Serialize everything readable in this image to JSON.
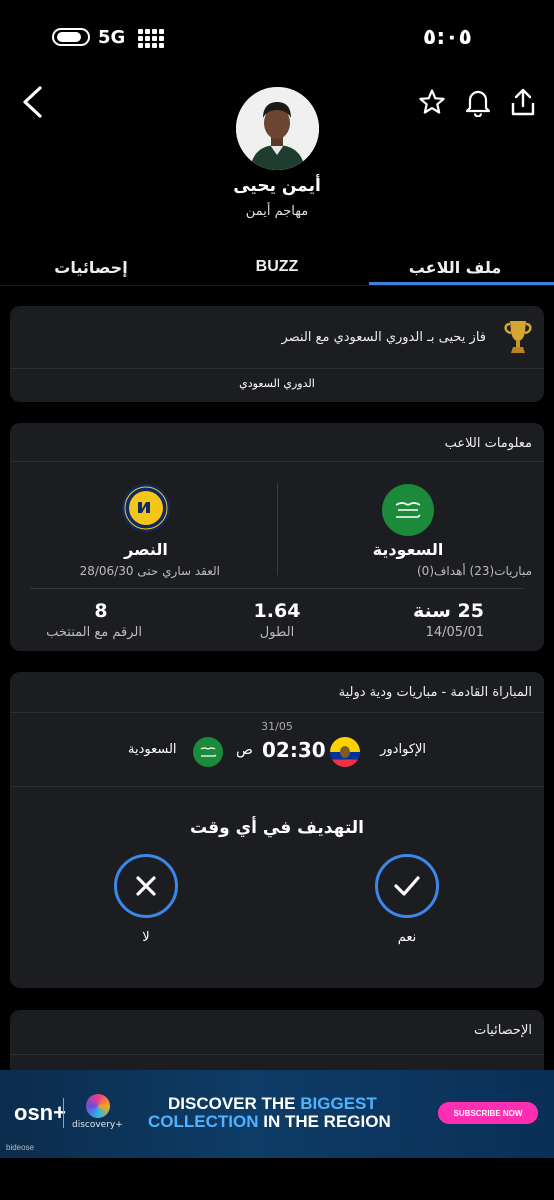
{
  "status_bar": {
    "network": "5G",
    "time": "٥:٠٥"
  },
  "header": {
    "back_icon": "chevron-left-icon",
    "star_icon": "star-icon",
    "bell_icon": "bell-icon",
    "share_icon": "share-icon"
  },
  "player": {
    "name": "أيمن يحيى",
    "position": "مهاجم أيمن"
  },
  "tabs": [
    {
      "label": "ملف اللاعب",
      "active": true
    },
    {
      "label": "BUZZ",
      "active": false
    },
    {
      "label": "إحصائيات",
      "active": false
    }
  ],
  "trophy": {
    "text": "فاز يحيى بـ الدوري السعودي مع النصر",
    "league": "الدوري السعودي"
  },
  "player_info": {
    "title": "معلومات اللاعب",
    "country": {
      "name": "السعودية",
      "detail": "مباريات(23) أهداف(0)"
    },
    "club": {
      "name": "النصر",
      "detail": "العقد ساري حتى 28/06/30"
    },
    "stats": [
      {
        "value": "25 سنة",
        "label": "14/05/01"
      },
      {
        "value": "1.64",
        "label": "الطول"
      },
      {
        "value": "8",
        "label": "الرقم مع المنتخب"
      }
    ]
  },
  "next_match": {
    "title": "المباراة القادمة - مباريات ودية دولية",
    "date": "31/05",
    "home_team": "الإكوادور",
    "away_team": "السعودية",
    "time": "02:30",
    "ampm": "ص"
  },
  "poll": {
    "question": "التهديف في أي وقت",
    "yes": "نعم",
    "no": "لا"
  },
  "stats_section": {
    "title": "الإحصائيات"
  },
  "ad": {
    "brand": "osn+",
    "partner": "discovery+",
    "line1_a": "DISCOVER THE",
    "line1_b": "BIGGEST",
    "line2_a": "COLLECTION",
    "line2_b": "IN THE REGION",
    "cta": "SUBSCRIBE NOW",
    "footer": "bideose"
  },
  "colors": {
    "accent": "#3f7fe0",
    "card": "#1c1d21",
    "saudi_green": "#1b8a3a",
    "nassr_yellow": "#f5c518"
  }
}
